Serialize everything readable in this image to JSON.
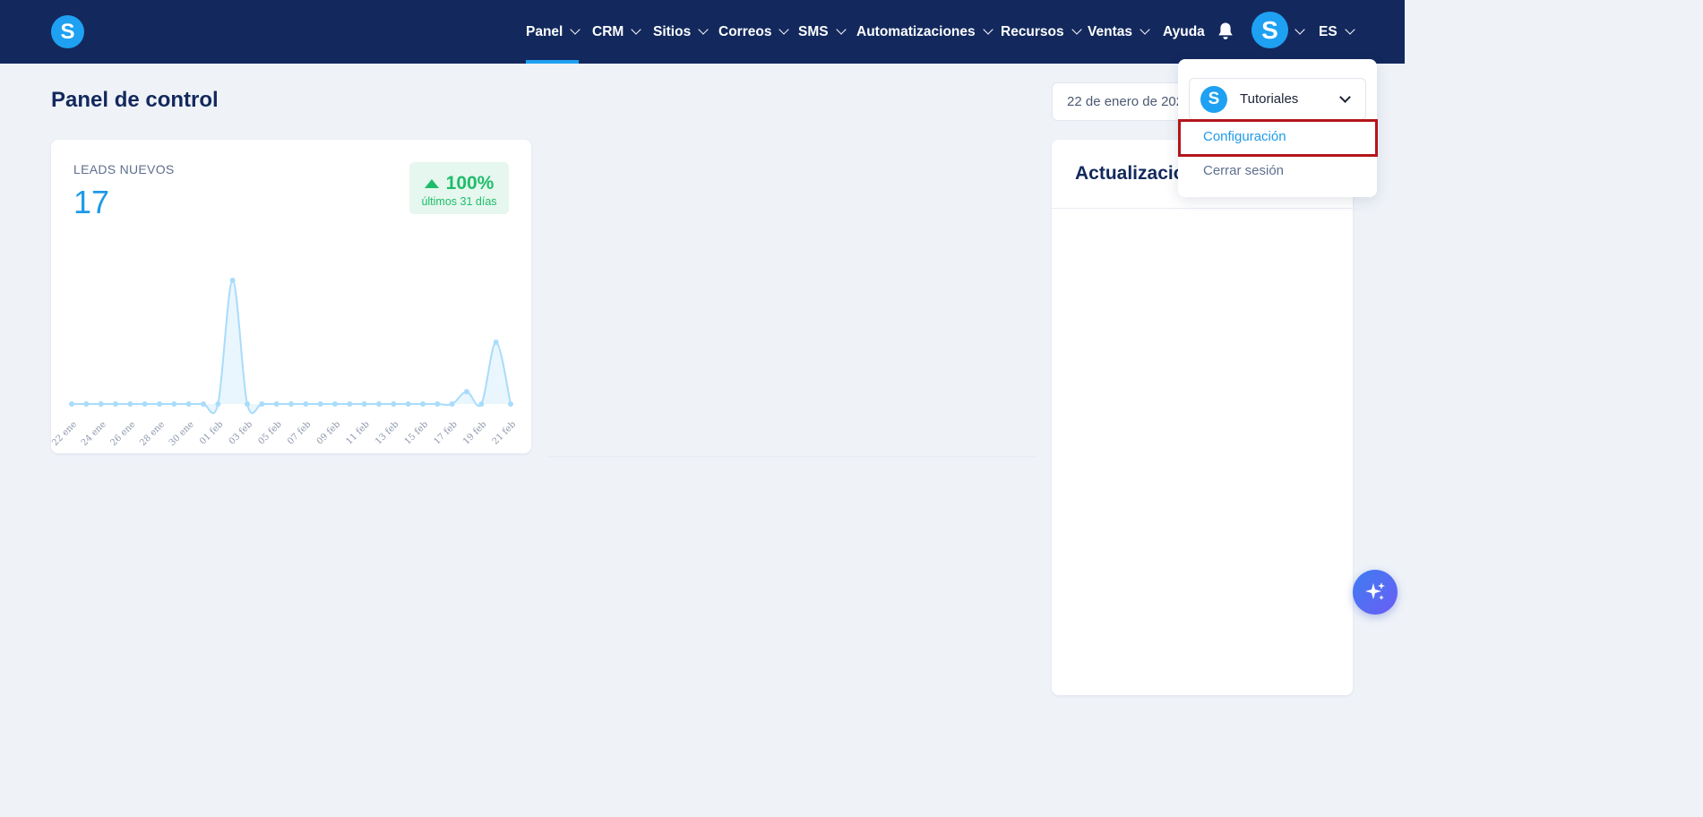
{
  "app": {
    "logo_letter": "S"
  },
  "nav": {
    "items": [
      {
        "label": "Panel",
        "has_chevron": true,
        "active": true
      },
      {
        "label": "CRM",
        "has_chevron": true
      },
      {
        "label": "Sitios",
        "has_chevron": true
      },
      {
        "label": "Correos",
        "has_chevron": true
      },
      {
        "label": "SMS",
        "has_chevron": true
      },
      {
        "label": "Automatizaciones",
        "has_chevron": true
      },
      {
        "label": "Recursos",
        "has_chevron": true
      },
      {
        "label": "Ventas",
        "has_chevron": true
      },
      {
        "label": "Ayuda",
        "has_chevron": false
      }
    ],
    "notifications_icon": "bell-icon",
    "avatar_letter": "S",
    "language": "ES"
  },
  "page": {
    "title": "Panel de control",
    "date_range": "22 de enero de 2025"
  },
  "leads": {
    "label": "LEADS NUEVOS",
    "value": "17",
    "trend_percent": "100%",
    "trend_period": "últimos 31 días",
    "trend_color": "#1fbd6b"
  },
  "chart_data": {
    "type": "area",
    "title": "",
    "x": [
      "22 ene",
      "23 ene",
      "24 ene",
      "25 ene",
      "26 ene",
      "27 ene",
      "28 ene",
      "29 ene",
      "30 ene",
      "31 ene",
      "01 feb",
      "02 feb",
      "03 feb",
      "04 feb",
      "05 feb",
      "06 feb",
      "07 feb",
      "08 feb",
      "09 feb",
      "10 feb",
      "11 feb",
      "12 feb",
      "13 feb",
      "14 feb",
      "15 feb",
      "16 feb",
      "17 feb",
      "18 feb",
      "19 feb",
      "20 feb",
      "21 feb"
    ],
    "tick_labels": [
      "22 ene",
      "24 ene",
      "26 ene",
      "28 ene",
      "30 ene",
      "01 feb",
      "03 feb",
      "05 feb",
      "07 feb",
      "09 feb",
      "11 feb",
      "13 feb",
      "15 feb",
      "17 feb",
      "19 feb",
      "21 feb"
    ],
    "values": [
      0,
      0,
      0,
      0,
      0,
      0,
      0,
      0,
      0,
      0,
      0,
      10,
      0,
      0,
      0,
      0,
      0,
      0,
      0,
      0,
      0,
      0,
      0,
      0,
      0,
      0,
      0,
      1,
      0,
      5,
      0
    ],
    "ylim": [
      0,
      10
    ],
    "grid": false,
    "color": "#a9dcfb"
  },
  "updates": {
    "title": "Actualizaciones"
  },
  "user_menu": {
    "account_name": "Tutoriales",
    "account_logo_letter": "S",
    "items": [
      {
        "label": "Configuración"
      },
      {
        "label": "Cerrar sesión"
      }
    ]
  },
  "fab": {
    "icon": "sparkle-icon"
  }
}
